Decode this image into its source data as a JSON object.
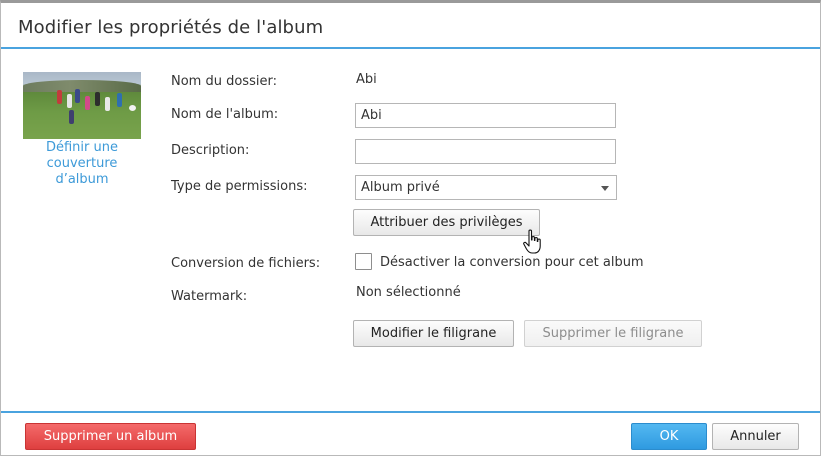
{
  "dialog": {
    "title": "Modifier les propriétés de l'album"
  },
  "cover": {
    "link_label": "Définir une couverture d’album"
  },
  "form": {
    "folder_name_label": "Nom du dossier:",
    "folder_name_value": "Abi",
    "album_name_label": "Nom de l'album:",
    "album_name_value": "Abi",
    "description_label": "Description:",
    "description_value": "",
    "permissions_label": "Type de permissions:",
    "permissions_value": "Album privé",
    "assign_privileges_button": "Attribuer des privilèges",
    "conversion_label": "Conversion de fichiers:",
    "conversion_checkbox_label": "Désactiver la conversion pour cet album",
    "conversion_checked": false,
    "watermark_label": "Watermark:",
    "watermark_value": "Non sélectionné",
    "modify_watermark_button": "Modifier le filigrane",
    "delete_watermark_button": "Supprimer le filigrane"
  },
  "footer": {
    "delete_album_button": "Supprimer un album",
    "ok_button": "OK",
    "cancel_button": "Annuler"
  },
  "colors": {
    "accent": "#4aa3df",
    "link": "#3d9ad8",
    "danger": "#de3f3f",
    "primary": "#2f9ae0"
  }
}
